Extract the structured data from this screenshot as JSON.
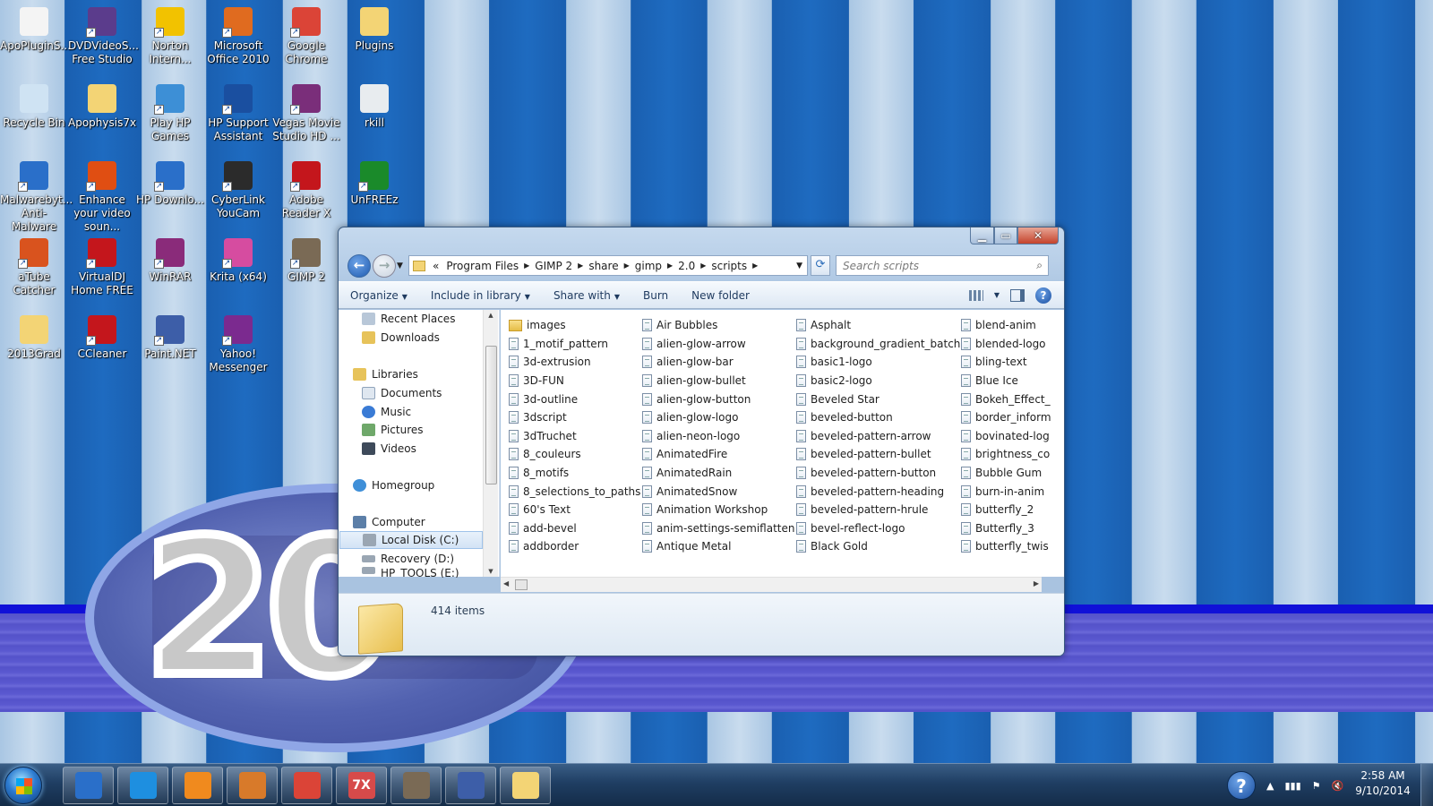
{
  "desktop": {
    "icons": [
      {
        "label": "ApoPluginS...",
        "icon": "document-icon",
        "color": "#f4f4f4"
      },
      {
        "label": "DVDVideoS... Free Studio",
        "icon": "dvdvideosoft-icon",
        "color": "#5b3c8c"
      },
      {
        "label": "Norton Intern...",
        "icon": "norton-icon",
        "color": "#f2c200"
      },
      {
        "label": "Microsoft Office 2010",
        "icon": "office-icon",
        "color": "#e06b1f"
      },
      {
        "label": "Google Chrome",
        "icon": "chrome-icon",
        "color": "#db4437"
      },
      {
        "label": "Plugins",
        "icon": "folder-icon",
        "color": "#f3d475"
      },
      {
        "label": "Recycle Bin",
        "icon": "recycle-bin-icon",
        "color": "#cfe3f3"
      },
      {
        "label": "Apophysis7x",
        "icon": "folder-icon",
        "color": "#f3d475"
      },
      {
        "label": "Play HP Games",
        "icon": "hp-games-icon",
        "color": "#3d8fd6"
      },
      {
        "label": "HP Support Assistant",
        "icon": "hp-support-icon",
        "color": "#1a4fa0"
      },
      {
        "label": "Vegas Movie Studio HD ...",
        "icon": "vegas-icon",
        "color": "#7a2e7a"
      },
      {
        "label": "rkill",
        "icon": "rkill-icon",
        "color": "#e8ecef"
      },
      {
        "label": "Malwarebyt... Anti-Malware",
        "icon": "malwarebytes-icon",
        "color": "#2a6fc9"
      },
      {
        "label": "Enhance your video soun...",
        "icon": "dfx-icon",
        "color": "#e04e12"
      },
      {
        "label": "HP Downlo...",
        "icon": "hp-download-icon",
        "color": "#2a6fc9"
      },
      {
        "label": "CyberLink YouCam",
        "icon": "youcam-icon",
        "color": "#2b2b2b"
      },
      {
        "label": "Adobe Reader X",
        "icon": "adobe-reader-icon",
        "color": "#c4161c"
      },
      {
        "label": "UnFREEz",
        "icon": "unfreez-icon",
        "color": "#1a8a2a"
      },
      {
        "label": "aTube Catcher",
        "icon": "atube-icon",
        "color": "#d9531e"
      },
      {
        "label": "VirtualDJ Home FREE",
        "icon": "virtualdj-icon",
        "color": "#c4161c"
      },
      {
        "label": "WinRAR",
        "icon": "winrar-icon",
        "color": "#8a2b7a"
      },
      {
        "label": "Krita (x64)",
        "icon": "krita-icon",
        "color": "#d64ca0"
      },
      {
        "label": "GIMP 2",
        "icon": "gimp-icon",
        "color": "#7a6a55"
      },
      {
        "label": "2013Grad",
        "icon": "folder-icon",
        "color": "#f3d475"
      },
      {
        "label": "CCleaner",
        "icon": "ccleaner-icon",
        "color": "#c4161c"
      },
      {
        "label": "Paint.NET",
        "icon": "paintnet-icon",
        "color": "#3d5ea8"
      },
      {
        "label": "Yahoo! Messenger",
        "icon": "yahoo-messenger-icon",
        "color": "#7b2a8f"
      }
    ],
    "wallpaper_text": "20"
  },
  "explorer": {
    "address": {
      "overflow": "«",
      "crumbs": [
        "Program Files",
        "GIMP 2",
        "share",
        "gimp",
        "2.0",
        "scripts"
      ]
    },
    "search_placeholder": "Search scripts",
    "toolbar": {
      "organize": "Organize",
      "include_in_library": "Include in library",
      "share_with": "Share with",
      "burn": "Burn",
      "new_folder": "New folder"
    },
    "nav": {
      "recent_places": "Recent Places",
      "downloads": "Downloads",
      "libraries": "Libraries",
      "documents": "Documents",
      "music": "Music",
      "pictures": "Pictures",
      "videos": "Videos",
      "homegroup": "Homegroup",
      "computer": "Computer",
      "local_disk": "Local Disk (C:)",
      "recovery": "Recovery (D:)",
      "hp_tools": "HP_TOOLS (E:)"
    },
    "files": {
      "col1": [
        "images",
        "1_motif_pattern",
        "3d-extrusion",
        "3D-FUN",
        "3d-outline",
        "3dscript",
        "3dTruchet",
        "8_couleurs",
        "8_motifs",
        "8_selections_to_paths",
        "60's Text",
        "add-bevel",
        "addborder"
      ],
      "col2": [
        "Air Bubbles",
        "alien-glow-arrow",
        "alien-glow-bar",
        "alien-glow-bullet",
        "alien-glow-button",
        "alien-glow-logo",
        "alien-neon-logo",
        "AnimatedFire",
        "AnimatedRain",
        "AnimatedSnow",
        "Animation Workshop",
        "anim-settings-semiflatten",
        "Antique Metal"
      ],
      "col3": [
        "Asphalt",
        "background_gradient_batch",
        "basic1-logo",
        "basic2-logo",
        "Beveled Star",
        "beveled-button",
        "beveled-pattern-arrow",
        "beveled-pattern-bullet",
        "beveled-pattern-button",
        "beveled-pattern-heading",
        "beveled-pattern-hrule",
        "bevel-reflect-logo",
        "Black Gold"
      ],
      "col4": [
        "blend-anim",
        "blended-logo",
        "bling-text",
        "Blue Ice",
        "Bokeh_Effect_",
        "border_inform",
        "bovinated-log",
        "brightness_co",
        "Bubble Gum",
        "burn-in-anim",
        "butterfly_2",
        "Butterfly_3",
        "butterfly_twis"
      ]
    },
    "status": {
      "item_count": "414 items"
    }
  },
  "taskbar": {
    "pinned": [
      {
        "app": "HP",
        "icon": "hp-icon",
        "color": "#2a6fc9"
      },
      {
        "app": "Internet Explorer",
        "icon": "internet-explorer-icon",
        "color": "#1e8fe0"
      },
      {
        "app": "Media Player",
        "icon": "media-player-icon",
        "color": "#f08a1e"
      },
      {
        "app": "Scanner",
        "icon": "scanner-icon",
        "color": "#d87a2a"
      },
      {
        "app": "Google Chrome",
        "icon": "chrome-icon",
        "color": "#db4437"
      },
      {
        "app": "7X",
        "icon": "apophysis-icon",
        "color": "#d64a4a",
        "label": "7X"
      },
      {
        "app": "GIMP",
        "icon": "gimp-icon",
        "color": "#7a6a55"
      },
      {
        "app": "Paint.NET",
        "icon": "paintnet-icon",
        "color": "#3d5ea8"
      },
      {
        "app": "Windows Explorer",
        "icon": "explorer-icon",
        "color": "#f3d475"
      }
    ],
    "clock": {
      "time": "2:58 AM",
      "date": "9/10/2014"
    }
  }
}
